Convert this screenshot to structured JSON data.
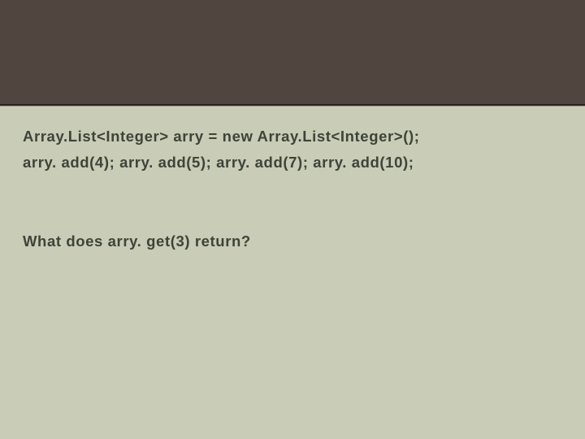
{
  "slide": {
    "code_line_1": "Array.List<Integer> arry = new Array.List<Integer>();",
    "code_line_2": "arry. add(4); arry. add(5); arry. add(7); arry. add(10);",
    "question": "What does arry. get(3) return?"
  }
}
